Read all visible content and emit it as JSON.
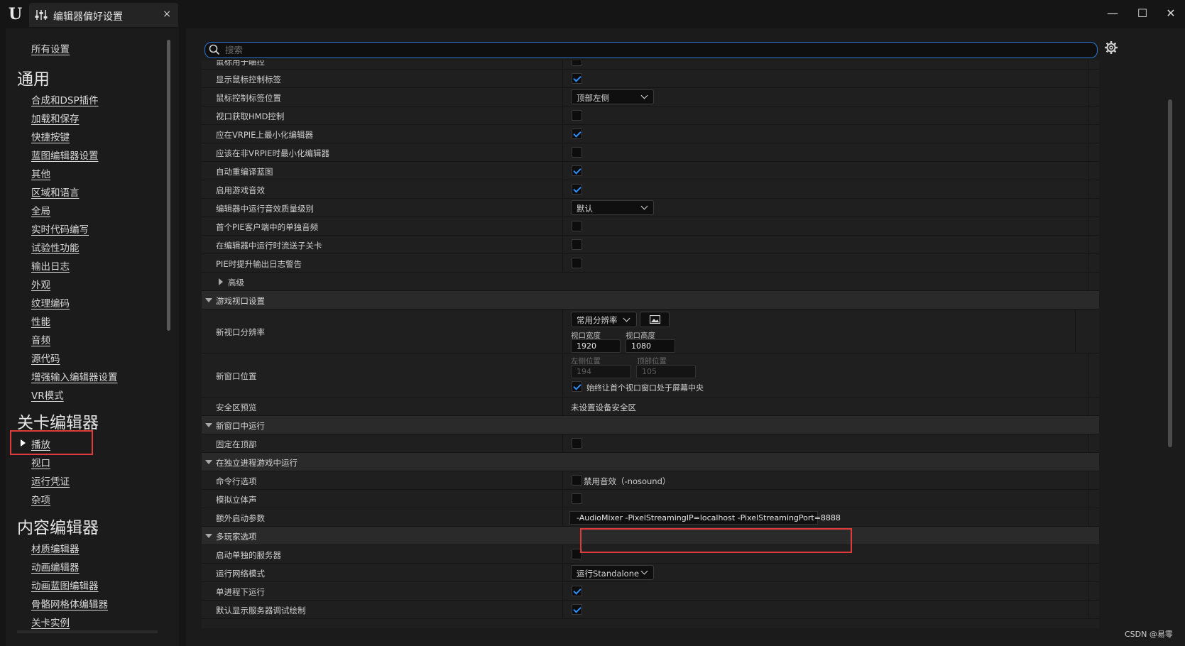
{
  "window": {
    "tab_title": "编辑器偏好设置",
    "tab_close": "×",
    "min": "—",
    "max": "☐",
    "close": "✕"
  },
  "sidebar": {
    "all_settings": "所有设置",
    "sections": [
      {
        "title": "通用",
        "items": [
          "合成和DSP插件",
          "加载和保存",
          "快捷按键",
          "蓝图编辑器设置",
          "其他",
          "区域和语言",
          "全局",
          "实时代码编写",
          "试验性功能",
          "输出日志",
          "外观",
          "纹理编码",
          "性能",
          "音频",
          "源代码",
          "增强输入编辑器设置",
          "VR模式"
        ]
      },
      {
        "title": "关卡编辑器",
        "items": [
          "播放",
          "视口",
          "运行凭证",
          "杂项"
        ],
        "selected": "播放"
      },
      {
        "title": "内容编辑器",
        "items": [
          "材质编辑器",
          "动画编辑器",
          "动画蓝图编辑器",
          "骨骼网格体编辑器",
          "关卡实例"
        ]
      }
    ]
  },
  "search": {
    "placeholder": "搜索",
    "value": ""
  },
  "rows": {
    "r0": "鼠标用于瞄控",
    "r1": "显示鼠标控制标签",
    "r2": "鼠标控制标签位置",
    "r2_value": "顶部左侧",
    "r3": "视口获取HMD控制",
    "r4": "应在VRPIE上最小化编辑器",
    "r5": "应该在非VRPIE时最小化编辑器",
    "r6": "自动重编译蓝图",
    "r7": "启用游戏音效",
    "r8": "编辑器中运行音效质量级别",
    "r8_value": "默认",
    "r9": "首个PIE客户端中的单独音频",
    "r10": "在编辑器中运行时流送子关卡",
    "r11": "PIE时提升输出日志警告",
    "r12": "高级",
    "cat1": "游戏视口设置",
    "r13": "新视口分辨率",
    "r13_dd": "常用分辨率",
    "r13_w_label": "视口宽度",
    "r13_h_label": "视口高度",
    "r13_w": "1920",
    "r13_h": "1080",
    "r14": "新窗口位置",
    "r14_l_label": "左侧位置",
    "r14_t_label": "顶部位置",
    "r14_l": "194",
    "r14_t": "105",
    "r14_center": "始终让首个视口窗口处于屏幕中央",
    "r15": "安全区预览",
    "r15_value": "未设置设备安全区",
    "cat2": "新窗口中运行",
    "r16": "固定在顶部",
    "cat3": "在独立进程游戏中运行",
    "r17": "命令行选项",
    "r17_value": "禁用音效（-nosound）",
    "r18": "模拟立体声",
    "r19": "额外启动参数",
    "r19_value": "-AudioMixer -PixelStreamingIP=localhost -PixelStreamingPort=8888",
    "cat4": "多玩家选项",
    "r20": "启动单独的服务器",
    "r21": "运行网络模式",
    "r21_value": "运行Standalone",
    "r22": "单进程下运行",
    "r23": "默认显示服务器调试绘制"
  },
  "checkboxes": {
    "r0": false,
    "r1": true,
    "r3": false,
    "r4": true,
    "r5": false,
    "r6": true,
    "r7": true,
    "r9": false,
    "r10": false,
    "r11": false,
    "r14_center": true,
    "r16": false,
    "r17": false,
    "r18": false,
    "r20": false,
    "r22": true,
    "r23": true
  },
  "colors": {
    "accent": "#2b78d4",
    "check": "#2b8cff",
    "highlight_box": "#e03a3a"
  },
  "watermark": "CSDN @易零"
}
